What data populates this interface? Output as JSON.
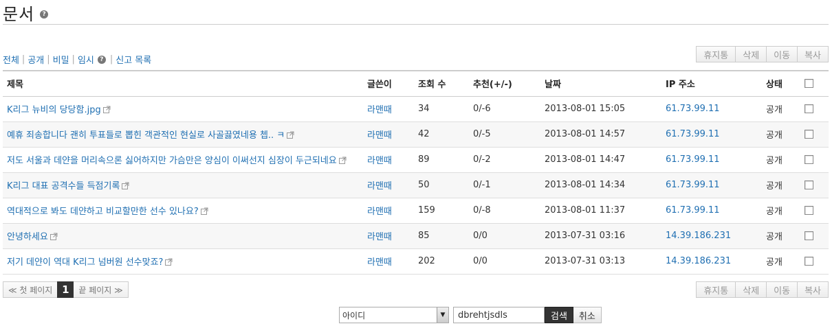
{
  "page": {
    "title": "문서"
  },
  "filters": {
    "all": "전체",
    "public": "공개",
    "secret": "비밀",
    "temp": "임시",
    "report": "신고 목록"
  },
  "actions": {
    "trash": "휴지통",
    "delete": "삭제",
    "move": "이동",
    "copy": "복사"
  },
  "columns": {
    "title": "제목",
    "author": "글쓴이",
    "views": "조회 수",
    "votes": "추천(+/-)",
    "date": "날짜",
    "ip": "IP 주소",
    "status": "상태"
  },
  "rows": [
    {
      "title": "K리그 뉴비의 당당함.jpg",
      "author": "라맨때",
      "views": "34",
      "votes": "0/-6",
      "date": "2013-08-01 15:05",
      "ip": "61.73.99.11",
      "status": "공개"
    },
    {
      "title": "예휴 죄송합니다 괜히 투표들로 뽑힌 객관적인 현실로 사골끓였네용 쳅.. ㅋ",
      "author": "라맨때",
      "views": "42",
      "votes": "0/-5",
      "date": "2013-08-01 14:57",
      "ip": "61.73.99.11",
      "status": "공개"
    },
    {
      "title": "저도 서울과 데얀을 머리속으론 싫어하지만 가슴만은 양심이 이써선지 심장이 두근되네요",
      "author": "라맨때",
      "views": "89",
      "votes": "0/-2",
      "date": "2013-08-01 14:47",
      "ip": "61.73.99.11",
      "status": "공개"
    },
    {
      "title": "K리그 대표 공격수들 득점기록",
      "author": "라맨때",
      "views": "50",
      "votes": "0/-1",
      "date": "2013-08-01 14:34",
      "ip": "61.73.99.11",
      "status": "공개"
    },
    {
      "title": "역대적으로 봐도 데얀하고 비교할만한 선수 있나요?",
      "author": "라맨때",
      "views": "159",
      "votes": "0/-8",
      "date": "2013-08-01 11:37",
      "ip": "61.73.99.11",
      "status": "공개"
    },
    {
      "title": "안녕하세요",
      "author": "라맨때",
      "views": "85",
      "votes": "0/0",
      "date": "2013-07-31 03:16",
      "ip": "14.39.186.231",
      "status": "공개"
    },
    {
      "title": "저기 데얀이 역대 K리그 넘버원 선수맞죠?",
      "author": "라맨때",
      "views": "202",
      "votes": "0/0",
      "date": "2013-07-31 03:13",
      "ip": "14.39.186.231",
      "status": "공개"
    }
  ],
  "pagination": {
    "first": "≪ 첫 페이지",
    "current": "1",
    "last": "끝 페이지 ≫"
  },
  "search": {
    "field": "아이디",
    "query": "dbrehtjsdls",
    "submit": "검색",
    "cancel": "취소"
  }
}
